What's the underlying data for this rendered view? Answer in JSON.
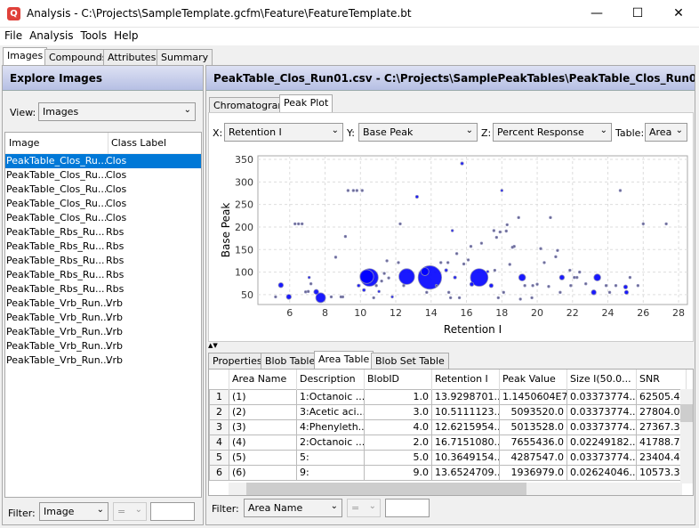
{
  "window": {
    "title": "Analysis - C:\\Projects\\SampleTemplate.gcfm\\Feature\\FeatureTemplate.bt",
    "icon": "magnifier-app-icon"
  },
  "menu": [
    "File",
    "Analysis",
    "Tools",
    "Help"
  ],
  "left_tabs": [
    "Images",
    "Compounds",
    "Attributes",
    "Summary"
  ],
  "left": {
    "header": "Explore Images",
    "view_label": "View:",
    "view_value": "Images",
    "columns": [
      "Image",
      "Class Label"
    ],
    "rows": [
      [
        "PeakTable_Clos_Ru...",
        "Clos"
      ],
      [
        "PeakTable_Clos_Ru...",
        "Clos"
      ],
      [
        "PeakTable_Clos_Ru...",
        "Clos"
      ],
      [
        "PeakTable_Clos_Ru...",
        "Clos"
      ],
      [
        "PeakTable_Clos_Ru...",
        "Clos"
      ],
      [
        "PeakTable_Rbs_Ru...",
        "Rbs"
      ],
      [
        "PeakTable_Rbs_Ru...",
        "Rbs"
      ],
      [
        "PeakTable_Rbs_Ru...",
        "Rbs"
      ],
      [
        "PeakTable_Rbs_Ru...",
        "Rbs"
      ],
      [
        "PeakTable_Rbs_Ru...",
        "Rbs"
      ],
      [
        "PeakTable_Vrb_Run...",
        "Vrb"
      ],
      [
        "PeakTable_Vrb_Run...",
        "Vrb"
      ],
      [
        "PeakTable_Vrb_Run...",
        "Vrb"
      ],
      [
        "PeakTable_Vrb_Run...",
        "Vrb"
      ],
      [
        "PeakTable_Vrb_Run...",
        "Vrb"
      ]
    ],
    "filter_label": "Filter:",
    "filter_field": "Image",
    "filter_op": "="
  },
  "right": {
    "header": "PeakTable_Clos_Run01.csv - C:\\Projects\\SamplePeakTables\\PeakTable_Clos_Run01.csv",
    "view_tabs": [
      "Chromatogram",
      "Peak Plot"
    ],
    "x_label": "X:",
    "x_value": "Retention I",
    "y_label": "Y:",
    "y_value": "Base Peak",
    "z_label": "Z:",
    "z_value": "Percent Response",
    "table_label": "Table:",
    "table_value": "Area",
    "bottom_tabs": [
      "Properties",
      "Blob Table",
      "Area Table",
      "Blob Set Table"
    ],
    "table": {
      "columns": [
        "",
        "Area Name",
        "Description",
        "BlobID",
        "Retention I",
        "Peak Value",
        "Size I(50.0...",
        "SNR"
      ],
      "rows": [
        [
          "1",
          "(1)",
          "1:Octanoic ...",
          "1.0",
          "13.9298701...",
          "1.1450604E7",
          "0.03373774...",
          "62505.475"
        ],
        [
          "2",
          "(2)",
          "3:Acetic aci...",
          "3.0",
          "10.5111123...",
          "5093520.0",
          "0.03373774...",
          "27804.026"
        ],
        [
          "3",
          "(3)",
          "4:Phenyleth...",
          "4.0",
          "12.6215954...",
          "5013528.0",
          "0.03373774...",
          "27367.373"
        ],
        [
          "4",
          "(4)",
          "2:Octanoic ...",
          "2.0",
          "16.7151080...",
          "7655436.0",
          "0.02249182...",
          "41788.771"
        ],
        [
          "5",
          "(5)",
          "5:",
          "5.0",
          "10.3649154...",
          "4287547.0",
          "0.03373774...",
          "23404.456"
        ],
        [
          "6",
          "(6)",
          "9:",
          "9.0",
          "13.6524709...",
          "1936979.0",
          "0.02624046...",
          "10573.398"
        ]
      ]
    },
    "filter_label": "Filter:",
    "filter_field": "Area Name",
    "filter_op": "="
  },
  "chart_data": {
    "type": "scatter",
    "xlabel": "Retention I",
    "ylabel": "Base Peak",
    "xlim": [
      4.2,
      28.5
    ],
    "ylim": [
      28,
      358
    ],
    "xticks": [
      6,
      8,
      10,
      12,
      14,
      16,
      18,
      20,
      22,
      24,
      26,
      28
    ],
    "yticks": [
      50,
      100,
      150,
      200,
      250,
      300,
      350
    ],
    "grid": true,
    "color": "#0000ff",
    "points": [
      [
        13.93,
        88,
        12
      ],
      [
        10.51,
        88,
        9
      ],
      [
        12.62,
        90,
        8
      ],
      [
        16.72,
        88,
        9
      ],
      [
        10.36,
        90,
        7
      ],
      [
        13.65,
        101,
        4
      ],
      [
        7.75,
        43,
        5
      ],
      [
        5.5,
        71,
        2.5
      ],
      [
        5.95,
        45,
        2.5
      ],
      [
        7.5,
        56,
        2.5
      ],
      [
        19.15,
        88,
        3.5
      ],
      [
        23.4,
        88,
        3.5
      ],
      [
        21.4,
        88,
        2.5
      ],
      [
        23.2,
        55,
        2.5
      ],
      [
        25,
        67,
        2
      ],
      [
        25.05,
        55,
        2
      ],
      [
        17.4,
        70,
        2
      ],
      [
        16.3,
        73,
        2
      ],
      [
        15.35,
        88,
        1.5
      ],
      [
        14.85,
        104,
        1.5
      ],
      [
        9.9,
        70,
        1.5
      ],
      [
        10.2,
        60,
        1.5
      ],
      [
        11.05,
        57,
        1.2
      ],
      [
        15.75,
        341,
        1.5
      ],
      [
        13.2,
        267,
        1.5
      ],
      [
        18,
        281,
        1.2
      ],
      [
        15.2,
        192,
        1.2
      ],
      [
        17.55,
        192,
        1
      ],
      [
        7.1,
        88,
        1.2
      ],
      [
        8.6,
        133,
        1
      ],
      [
        11.8,
        45,
        1.2
      ],
      [
        8.35,
        45,
        1
      ],
      [
        5.2,
        45,
        1
      ],
      [
        6.9,
        56,
        1
      ],
      [
        7.05,
        57,
        1
      ],
      [
        7.2,
        74,
        0.8
      ],
      [
        6.3,
        207,
        0.8
      ],
      [
        6.5,
        207,
        0.8
      ],
      [
        6.7,
        207,
        0.8
      ],
      [
        9.3,
        281,
        0.6
      ],
      [
        9.6,
        281,
        0.6
      ],
      [
        9.8,
        281,
        0.6
      ],
      [
        10.1,
        281,
        0.6
      ],
      [
        9.15,
        179,
        0.6
      ],
      [
        12.25,
        207,
        0.6
      ],
      [
        12.15,
        121,
        0.6
      ],
      [
        11.5,
        125,
        0.5
      ],
      [
        11.35,
        97,
        0.7
      ],
      [
        11.6,
        87,
        0.7
      ],
      [
        11.2,
        80,
        0.7
      ],
      [
        10.9,
        70,
        0.7
      ],
      [
        10.75,
        43,
        0.7
      ],
      [
        12.45,
        70,
        0.7
      ],
      [
        13.75,
        55,
        0.8
      ],
      [
        14.3,
        70,
        0.7
      ],
      [
        14.55,
        121,
        0.6
      ],
      [
        14.95,
        121,
        0.6
      ],
      [
        15.45,
        141,
        0.6
      ],
      [
        15.85,
        118,
        0.6
      ],
      [
        16.1,
        127,
        0.6
      ],
      [
        16.25,
        157,
        0.7
      ],
      [
        16.85,
        164,
        0.6
      ],
      [
        17.2,
        101,
        1.2
      ],
      [
        17.6,
        104,
        0.6
      ],
      [
        17.7,
        177,
        0.7
      ],
      [
        17.9,
        189,
        0.6
      ],
      [
        18.25,
        191,
        0.7
      ],
      [
        18.3,
        205,
        0.6
      ],
      [
        18.45,
        117,
        0.7
      ],
      [
        18.6,
        155,
        0.7
      ],
      [
        18.7,
        157,
        0.6
      ],
      [
        18.95,
        221,
        0.6
      ],
      [
        19.05,
        40,
        0.6
      ],
      [
        19.3,
        70,
        0.7
      ],
      [
        19.75,
        70,
        0.7
      ],
      [
        19.7,
        43,
        0.6
      ],
      [
        20,
        73,
        0.7
      ],
      [
        20.2,
        152,
        0.6
      ],
      [
        20.4,
        121,
        0.6
      ],
      [
        20.65,
        68,
        0.6
      ],
      [
        20.75,
        221,
        0.6
      ],
      [
        21.05,
        134,
        0.6
      ],
      [
        21.15,
        148,
        0.6
      ],
      [
        21.3,
        55,
        0.6
      ],
      [
        21.85,
        104,
        0.5
      ],
      [
        21.9,
        70,
        0.6
      ],
      [
        22.1,
        88,
        0.5
      ],
      [
        22.25,
        88,
        0.5
      ],
      [
        22.4,
        100,
        0.5
      ],
      [
        22.75,
        74,
        0.5
      ],
      [
        23.9,
        70,
        0.5
      ],
      [
        24.1,
        55,
        0.5
      ],
      [
        24.45,
        70,
        0.5
      ],
      [
        24.7,
        281,
        0.5
      ],
      [
        25.25,
        88,
        0.7
      ],
      [
        25.7,
        70,
        0.5
      ],
      [
        26,
        207,
        0.5
      ],
      [
        27.3,
        207,
        0.5
      ],
      [
        15.6,
        43,
        0.6
      ],
      [
        17.8,
        43,
        0.6
      ],
      [
        18.1,
        55,
        0.5
      ],
      [
        15.1,
        43,
        0.6
      ],
      [
        15,
        55,
        0.6
      ],
      [
        9.0,
        45,
        0.5
      ],
      [
        8.9,
        45,
        0.5
      ]
    ]
  }
}
